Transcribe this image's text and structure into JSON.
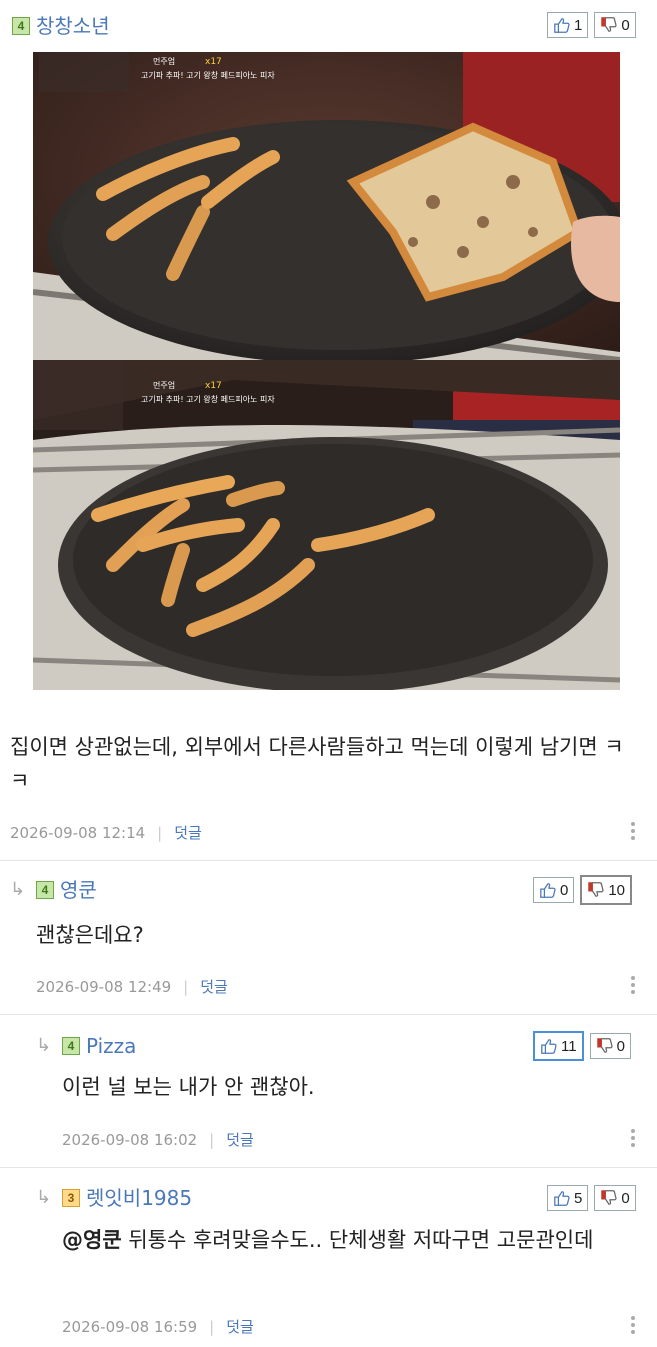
{
  "comments": [
    {
      "level": "4",
      "nickname": "창창소년",
      "likes": "1",
      "dislikes": "0",
      "text": "집이면 상관없는데, 외부에서 다른사람들하고 먹는데 이렇게 남기면 ㅋㅋ",
      "date": "2026-09-08 12:14",
      "reply": "덧글",
      "overlay_line1": "먼주업",
      "overlay_line2": "고기파 추파! 고기 왕창 페드피아노 피자",
      "overlay_badge": "x17"
    },
    {
      "level": "4",
      "nickname": "영쿤",
      "likes": "0",
      "dislikes": "10",
      "text": "괜찮은데요?",
      "date": "2026-09-08 12:49",
      "reply": "덧글"
    },
    {
      "level": "4",
      "nickname": "Pizza",
      "likes": "11",
      "dislikes": "0",
      "text": "이런 널 보는 내가 안 괜찮아.",
      "date": "2026-09-08 16:02",
      "reply": "덧글"
    },
    {
      "level": "3",
      "nickname": "렛잇비1985",
      "likes": "5",
      "dislikes": "0",
      "mention": "@영쿤",
      "text": " 뒤통수 후려맞을수도.. 단체생활 저따구면 고문관인데",
      "date": "2026-09-08 16:59",
      "reply": "덧글"
    }
  ],
  "icons": {
    "like": "thumbs-up-icon",
    "dislike": "thumbs-down-icon",
    "reply_arrow": "reply-arrow-icon",
    "more": "more-vertical-icon"
  },
  "colors": {
    "nickname": "#4a78b8",
    "like_active": "#4a90d9",
    "level4": "#c9e6a9",
    "level3": "#ffd98c"
  }
}
